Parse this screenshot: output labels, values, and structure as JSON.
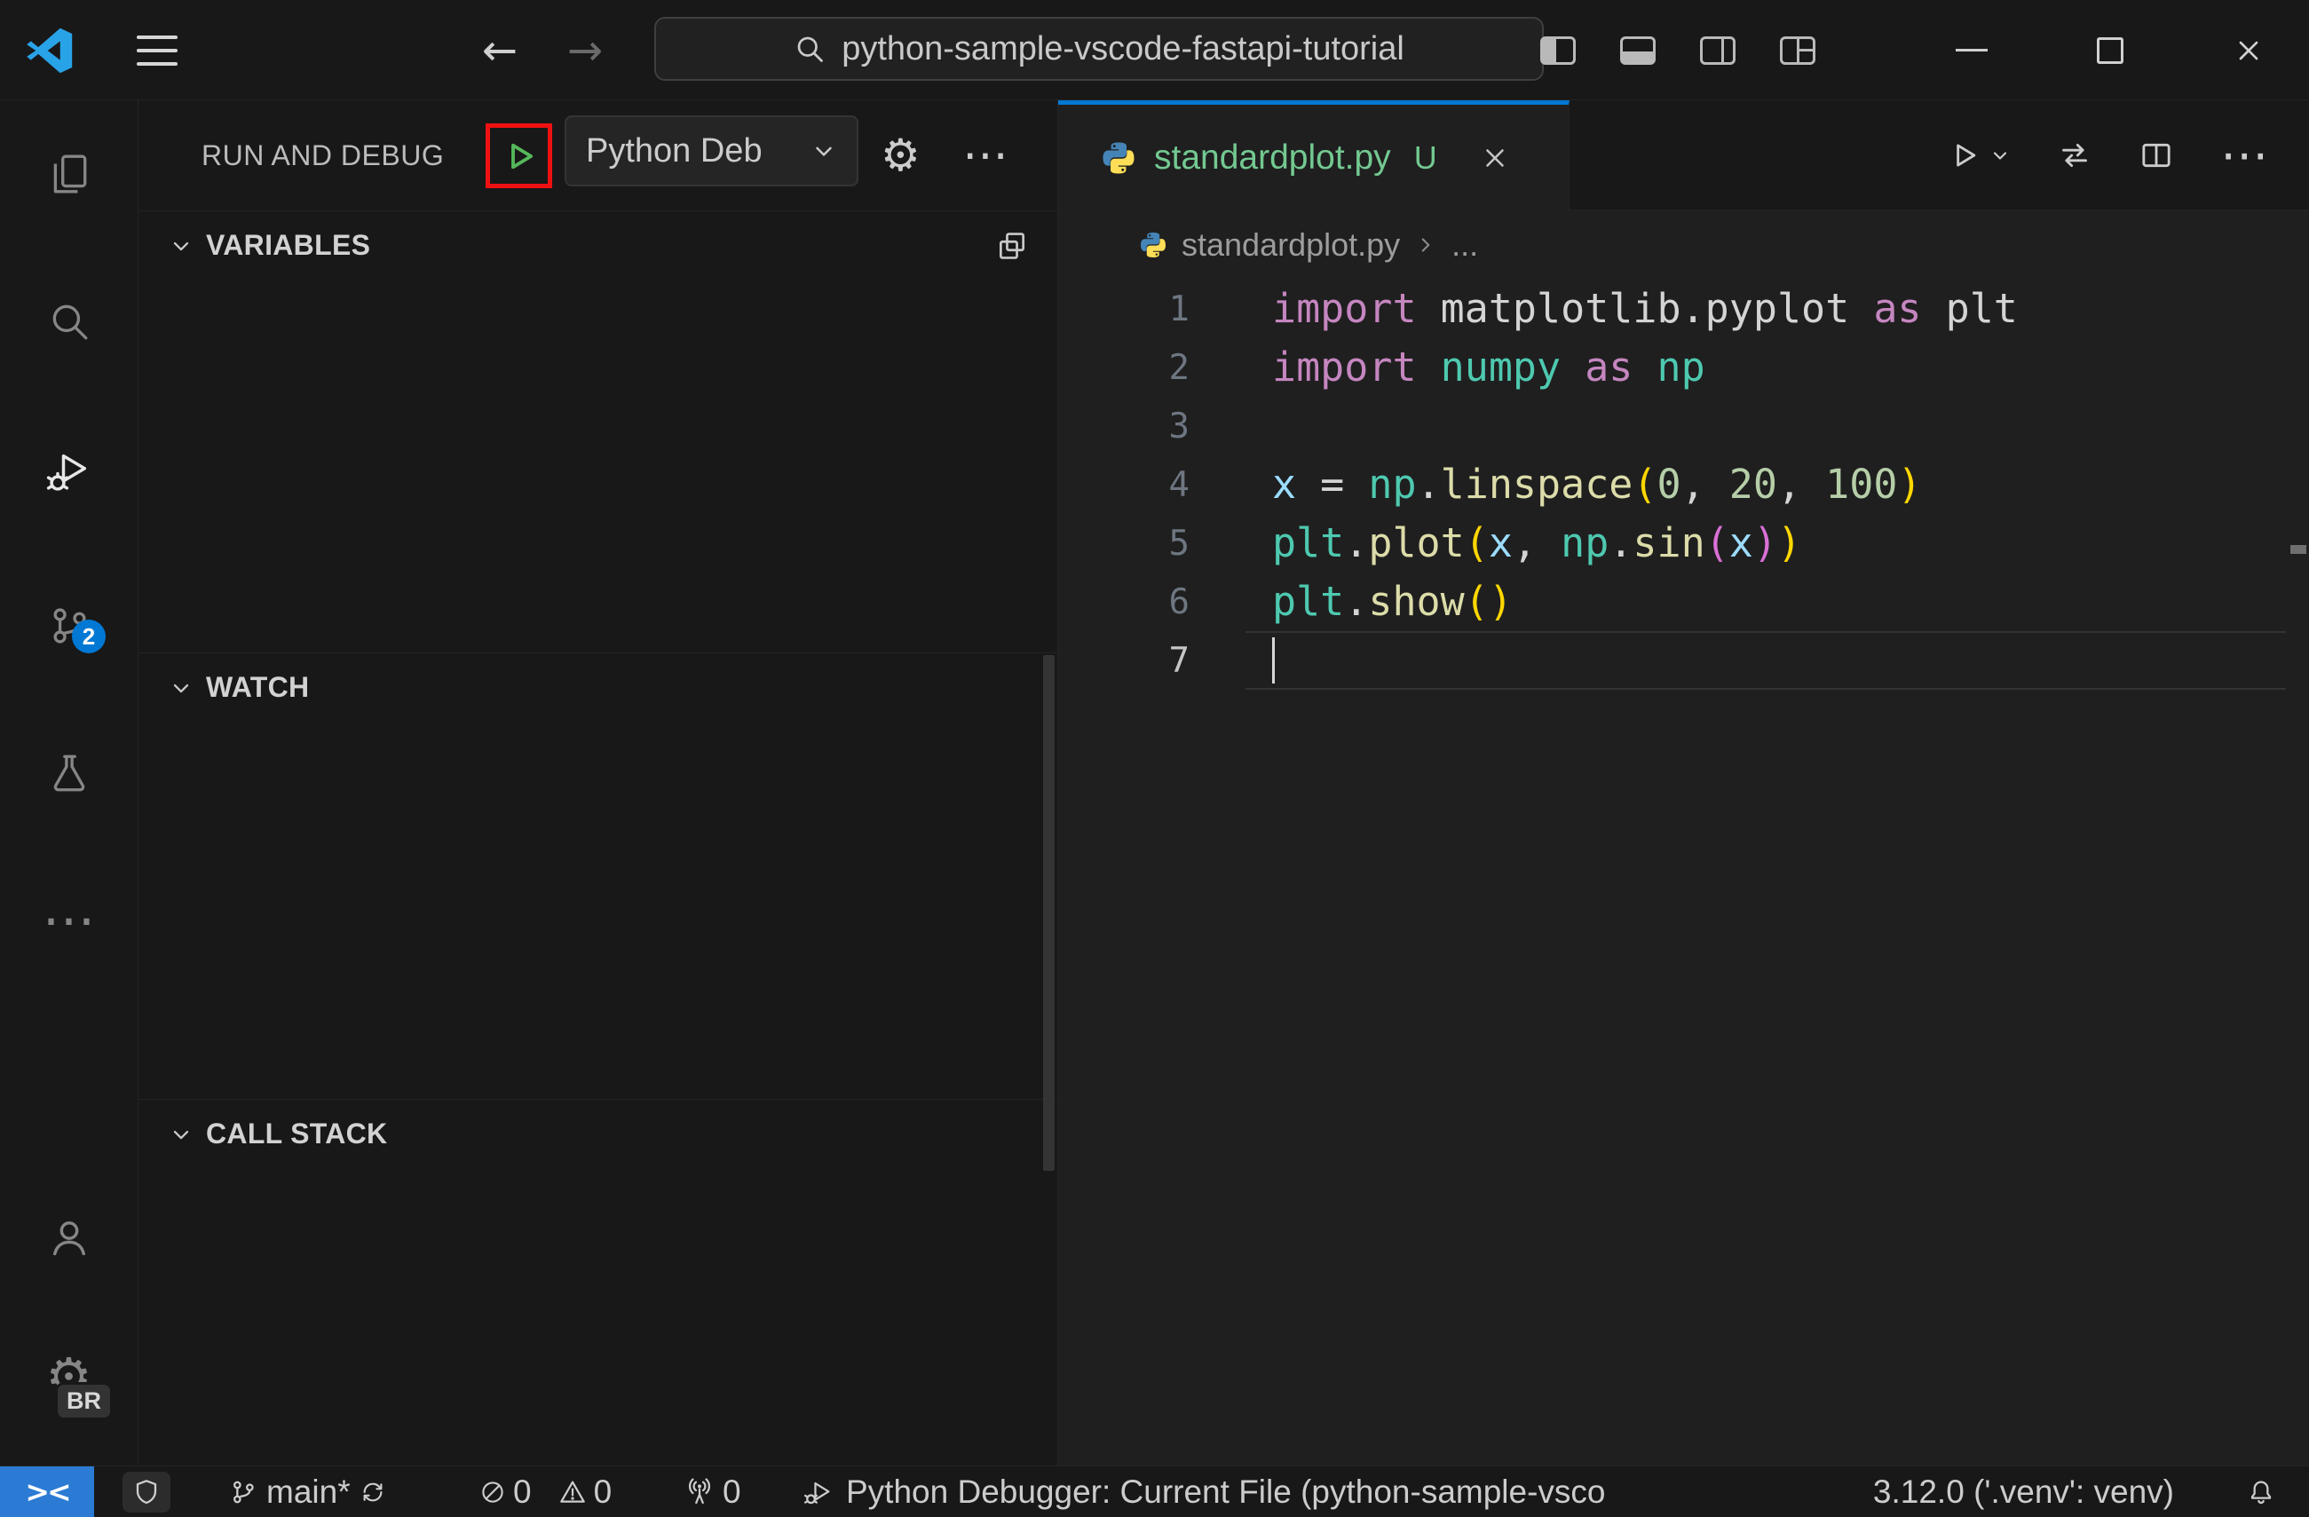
{
  "window": {
    "search_value": "python-sample-vscode-fastapi-tutorial"
  },
  "activity_bar": {
    "source_control_badge": "2",
    "profile_badge": "BR"
  },
  "sidebar": {
    "title": "RUN AND DEBUG",
    "debug_config_label": "Python Deb",
    "sections": [
      {
        "label": "VARIABLES"
      },
      {
        "label": "WATCH"
      },
      {
        "label": "CALL STACK"
      }
    ]
  },
  "editor": {
    "tab_label": "standardplot.py",
    "tab_git_marker": "U",
    "breadcrumb_file": "standardplot.py",
    "breadcrumb_more": "...",
    "syntax_colors": {
      "keyword": "#c586c0",
      "module": "#4ec9b0",
      "plain": "#d4d4d4",
      "variable": "#9cdcfe",
      "function": "#dcdcaa",
      "number": "#b5cea8",
      "bracket1": "#ffd700",
      "bracket2": "#da70d6"
    },
    "lines": [
      {
        "num": 1,
        "segments": [
          {
            "t": "import",
            "c": "keyword"
          },
          {
            "t": " matplotlib.pyplot ",
            "c": "plain"
          },
          {
            "t": "as",
            "c": "keyword"
          },
          {
            "t": " plt",
            "c": "plain"
          }
        ]
      },
      {
        "num": 2,
        "segments": [
          {
            "t": "import",
            "c": "keyword"
          },
          {
            "t": " ",
            "c": "plain"
          },
          {
            "t": "numpy",
            "c": "module"
          },
          {
            "t": " ",
            "c": "plain"
          },
          {
            "t": "as",
            "c": "keyword"
          },
          {
            "t": " ",
            "c": "plain"
          },
          {
            "t": "np",
            "c": "module"
          }
        ]
      },
      {
        "num": 3,
        "segments": []
      },
      {
        "num": 4,
        "segments": [
          {
            "t": "x",
            "c": "variable"
          },
          {
            "t": " = ",
            "c": "plain"
          },
          {
            "t": "np",
            "c": "module"
          },
          {
            "t": ".",
            "c": "plain"
          },
          {
            "t": "linspace",
            "c": "function"
          },
          {
            "t": "(",
            "c": "bracket1"
          },
          {
            "t": "0",
            "c": "number"
          },
          {
            "t": ", ",
            "c": "plain"
          },
          {
            "t": "20",
            "c": "number"
          },
          {
            "t": ", ",
            "c": "plain"
          },
          {
            "t": "100",
            "c": "number"
          },
          {
            "t": ")",
            "c": "bracket1"
          }
        ]
      },
      {
        "num": 5,
        "segments": [
          {
            "t": "plt",
            "c": "module"
          },
          {
            "t": ".",
            "c": "plain"
          },
          {
            "t": "plot",
            "c": "function"
          },
          {
            "t": "(",
            "c": "bracket1"
          },
          {
            "t": "x",
            "c": "variable"
          },
          {
            "t": ", ",
            "c": "plain"
          },
          {
            "t": "np",
            "c": "module"
          },
          {
            "t": ".",
            "c": "plain"
          },
          {
            "t": "sin",
            "c": "function"
          },
          {
            "t": "(",
            "c": "bracket2"
          },
          {
            "t": "x",
            "c": "variable"
          },
          {
            "t": ")",
            "c": "bracket2"
          },
          {
            "t": ")",
            "c": "bracket1"
          }
        ]
      },
      {
        "num": 6,
        "segments": [
          {
            "t": "plt",
            "c": "module"
          },
          {
            "t": ".",
            "c": "plain"
          },
          {
            "t": "show",
            "c": "function"
          },
          {
            "t": "(",
            "c": "bracket1"
          },
          {
            "t": ")",
            "c": "bracket1"
          }
        ]
      },
      {
        "num": 7,
        "segments": [],
        "cursor": true
      }
    ]
  },
  "status_bar": {
    "remote_glyph": "><",
    "branch": "main*",
    "error_count": "0",
    "warning_count": "0",
    "port_count": "0",
    "debug_status": "Python Debugger: Current File (python-sample-vsco",
    "python_version": "3.12.0 ('.venv': venv)"
  },
  "colors": {
    "accent_blue": "#0078d4",
    "remote_blue": "#2b7bd4",
    "untracked_green": "#73c991",
    "run_green": "#55b85a",
    "annotation_red": "#ee1111"
  }
}
